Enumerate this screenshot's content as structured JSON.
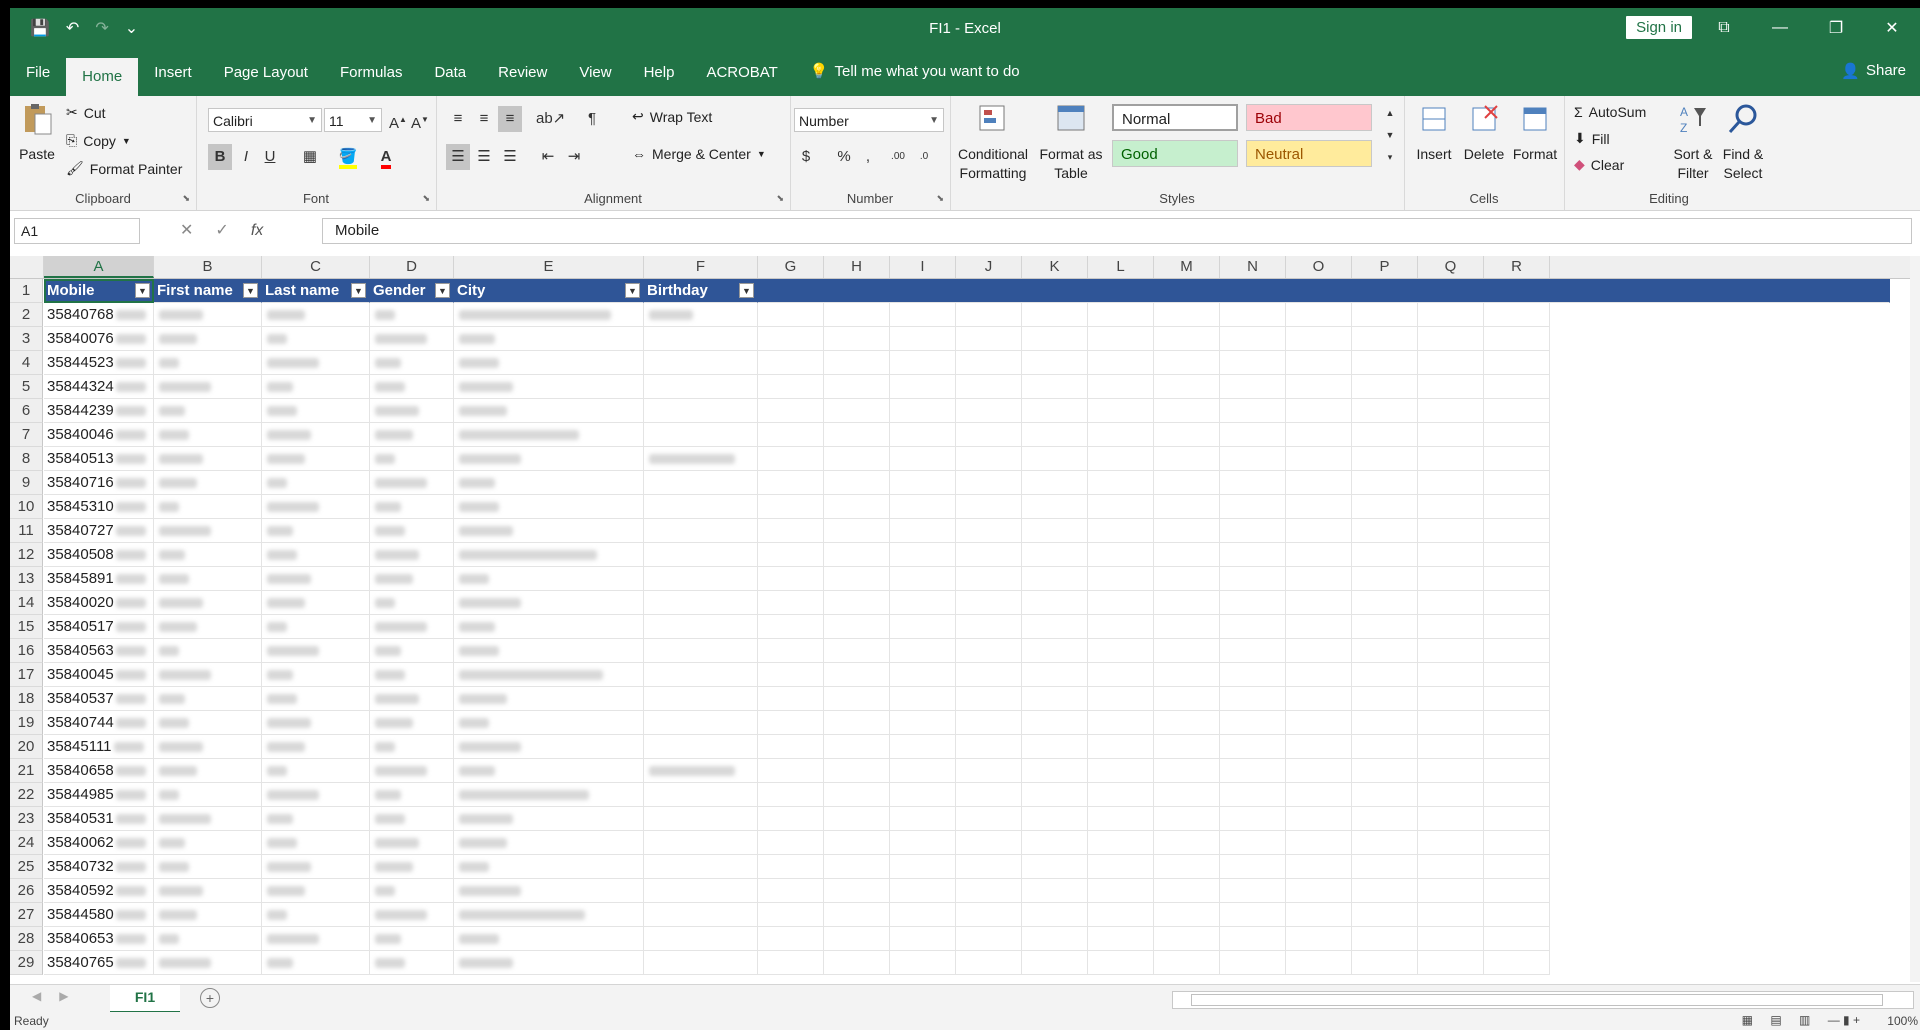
{
  "window": {
    "title": "FI1  -  Excel",
    "signin": "Sign in",
    "controls": [
      "⧉",
      "—",
      "❐",
      "✕"
    ]
  },
  "qat": {
    "save": "💾",
    "undo": "↶",
    "redo": "↷",
    "customize": "⌄"
  },
  "menu": {
    "tabs": [
      "File",
      "Home",
      "Insert",
      "Page Layout",
      "Formulas",
      "Data",
      "Review",
      "View",
      "Help",
      "ACROBAT"
    ],
    "active": "Home",
    "tell_me": "Tell me what you want to do",
    "share": "Share"
  },
  "ribbon": {
    "clipboard": {
      "label": "Clipboard",
      "paste": "Paste",
      "cut": "Cut",
      "copy": "Copy",
      "format_painter": "Format Painter"
    },
    "font": {
      "label": "Font",
      "family": "Calibri",
      "size": "11",
      "bold": "B",
      "italic": "I",
      "underline": "U"
    },
    "alignment": {
      "label": "Alignment",
      "wrap": "Wrap Text",
      "merge": "Merge & Center"
    },
    "number": {
      "label": "Number",
      "format": "Number",
      "currency": "$",
      "percent": "%",
      "comma": ","
    },
    "styles": {
      "label": "Styles",
      "conditional": "Conditional Formatting",
      "format_table": "Format as Table",
      "normal": "Normal",
      "bad": "Bad",
      "good": "Good",
      "neutral": "Neutral",
      "colors": {
        "normal_bg": "#ffffff",
        "bad_bg": "#ffc7ce",
        "bad_fg": "#9c0006",
        "good_bg": "#c6efce",
        "good_fg": "#006100",
        "neutral_bg": "#ffeb9c",
        "neutral_fg": "#9c5700"
      }
    },
    "cells": {
      "label": "Cells",
      "insert": "Insert",
      "delete": "Delete",
      "format": "Format"
    },
    "editing": {
      "label": "Editing",
      "autosum": "AutoSum",
      "fill": "Fill",
      "clear": "Clear",
      "sort": "Sort & Filter",
      "find": "Find & Select"
    }
  },
  "formula_bar": {
    "name_box": "A1",
    "fx": "fx",
    "content": "Mobile"
  },
  "columns": [
    "A",
    "B",
    "C",
    "D",
    "E",
    "F",
    "G",
    "H",
    "I",
    "J",
    "K",
    "L",
    "M",
    "N",
    "O",
    "P",
    "Q",
    "R"
  ],
  "table_headers": [
    "Mobile",
    "First name",
    "Last name",
    "Gender",
    "City",
    "Birthday"
  ],
  "rows": [
    {
      "n": "2",
      "mobile": "35840768"
    },
    {
      "n": "3",
      "mobile": "35840076"
    },
    {
      "n": "4",
      "mobile": "35844523"
    },
    {
      "n": "5",
      "mobile": "35844324"
    },
    {
      "n": "6",
      "mobile": "35844239"
    },
    {
      "n": "7",
      "mobile": "35840046"
    },
    {
      "n": "8",
      "mobile": "35840513"
    },
    {
      "n": "9",
      "mobile": "35840716"
    },
    {
      "n": "10",
      "mobile": "35845310"
    },
    {
      "n": "11",
      "mobile": "35840727"
    },
    {
      "n": "12",
      "mobile": "35840508"
    },
    {
      "n": "13",
      "mobile": "35845891"
    },
    {
      "n": "14",
      "mobile": "35840020"
    },
    {
      "n": "15",
      "mobile": "35840517"
    },
    {
      "n": "16",
      "mobile": "35840563"
    },
    {
      "n": "17",
      "mobile": "35840045"
    },
    {
      "n": "18",
      "mobile": "35840537"
    },
    {
      "n": "19",
      "mobile": "35840744"
    },
    {
      "n": "20",
      "mobile": "35845111"
    },
    {
      "n": "21",
      "mobile": "35840658"
    },
    {
      "n": "22",
      "mobile": "35844985"
    },
    {
      "n": "23",
      "mobile": "35840531"
    },
    {
      "n": "24",
      "mobile": "35840062"
    },
    {
      "n": "25",
      "mobile": "35840732"
    },
    {
      "n": "26",
      "mobile": "35840592"
    },
    {
      "n": "27",
      "mobile": "35844580"
    },
    {
      "n": "28",
      "mobile": "35840653"
    },
    {
      "n": "29",
      "mobile": "35840765"
    }
  ],
  "sheet": {
    "tab": "FI1",
    "add": "+"
  },
  "status": {
    "ready": "Ready",
    "zoom": "100%"
  },
  "colors": {
    "excel_green": "#217346",
    "table_header": "#2f5597"
  }
}
